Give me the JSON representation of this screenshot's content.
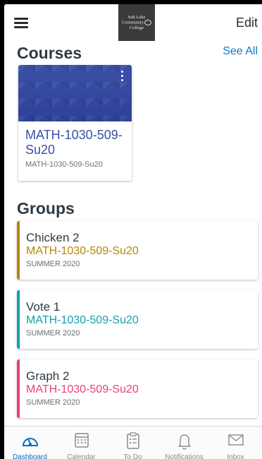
{
  "header": {
    "logo_lines": [
      "Salt Lake",
      "Community",
      "College"
    ],
    "edit_label": "Edit"
  },
  "courses": {
    "title": "Courses",
    "see_all_label": "See All",
    "items": [
      {
        "name": "MATH-1030-509-Su20",
        "code": "MATH-1030-509-Su20",
        "color": "#3a4fa5"
      }
    ]
  },
  "groups": {
    "title": "Groups",
    "items": [
      {
        "name": "Chicken 2",
        "course": "MATH-1030-509-Su20",
        "term": "SUMMER 2020",
        "color": "#b8860b"
      },
      {
        "name": "Vote 1",
        "course": "MATH-1030-509-Su20",
        "term": "SUMMER 2020",
        "color": "#14a0ad"
      },
      {
        "name": "Graph 2",
        "course": "MATH-1030-509-Su20",
        "term": "SUMMER 2020",
        "color": "#e8417a"
      }
    ]
  },
  "tabbar": {
    "items": [
      {
        "label": "Dashboard",
        "icon": "dashboard-icon",
        "active": true
      },
      {
        "label": "Calendar",
        "icon": "calendar-icon",
        "active": false
      },
      {
        "label": "To Do",
        "icon": "todo-icon",
        "active": false
      },
      {
        "label": "Notifications",
        "icon": "bell-icon",
        "active": false
      },
      {
        "label": "Inbox",
        "icon": "mail-icon",
        "active": false
      }
    ]
  },
  "colors": {
    "accent": "#0a7ad1",
    "heading": "#2d3b45"
  }
}
